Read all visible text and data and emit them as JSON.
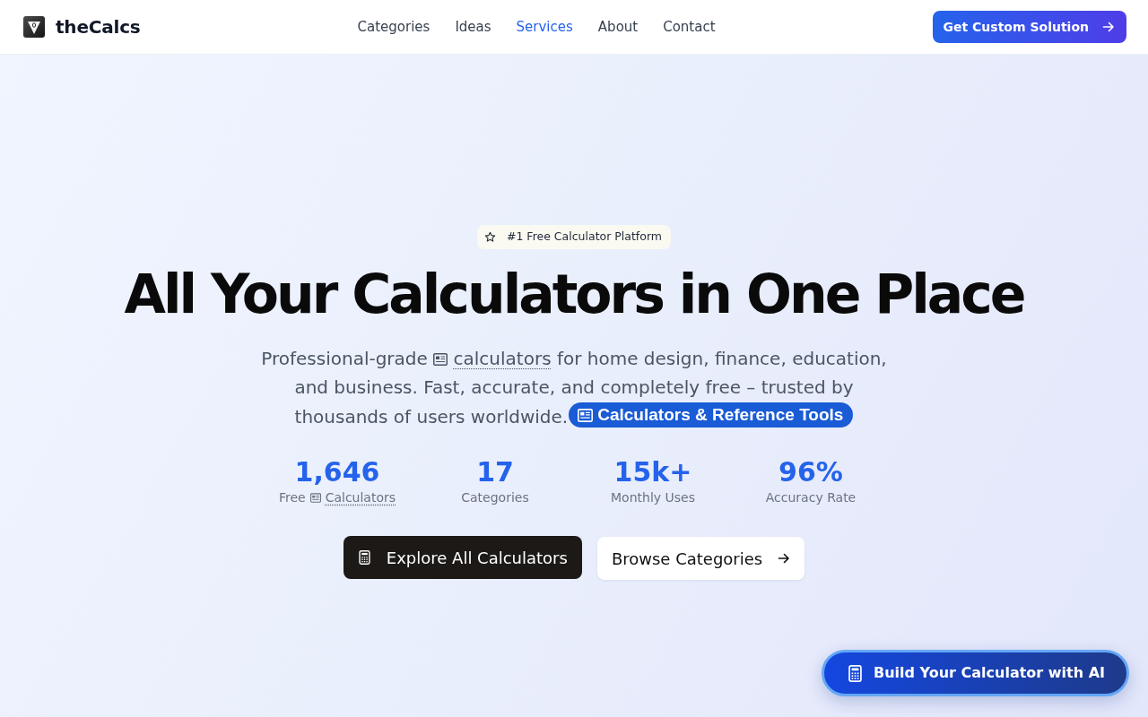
{
  "header": {
    "brand": "theCalcs",
    "nav": [
      {
        "label": "Categories",
        "selected": false
      },
      {
        "label": "Ideas",
        "selected": false
      },
      {
        "label": "Services",
        "selected": true
      },
      {
        "label": "About",
        "selected": false
      },
      {
        "label": "Contact",
        "selected": false
      }
    ],
    "cta": "Get Custom Solution"
  },
  "hero": {
    "badge": "#1 Free Calculator Platform",
    "title": "All Your Calculators in One Place",
    "description": {
      "lead": "Professional-grade",
      "link": "calculators",
      "rest": "for home design, finance, education, and business. Fast, accurate, and completely free – trusted by thousands of users worldwide.",
      "pill": "Calculators & Reference Tools"
    },
    "stats": [
      {
        "value": "1,646",
        "label": "Free",
        "link": "Calculators"
      },
      {
        "value": "17",
        "label": "Categories"
      },
      {
        "value": "15k+",
        "label": "Monthly Uses"
      },
      {
        "value": "96%",
        "label": "Accuracy Rate"
      }
    ],
    "actions": [
      {
        "kind": "primary",
        "label": "Explore All Calculators"
      },
      {
        "kind": "secondary",
        "label": "Browse Categories"
      }
    ]
  },
  "floating_button": {
    "label": "Build Your Calculator with AI"
  }
}
